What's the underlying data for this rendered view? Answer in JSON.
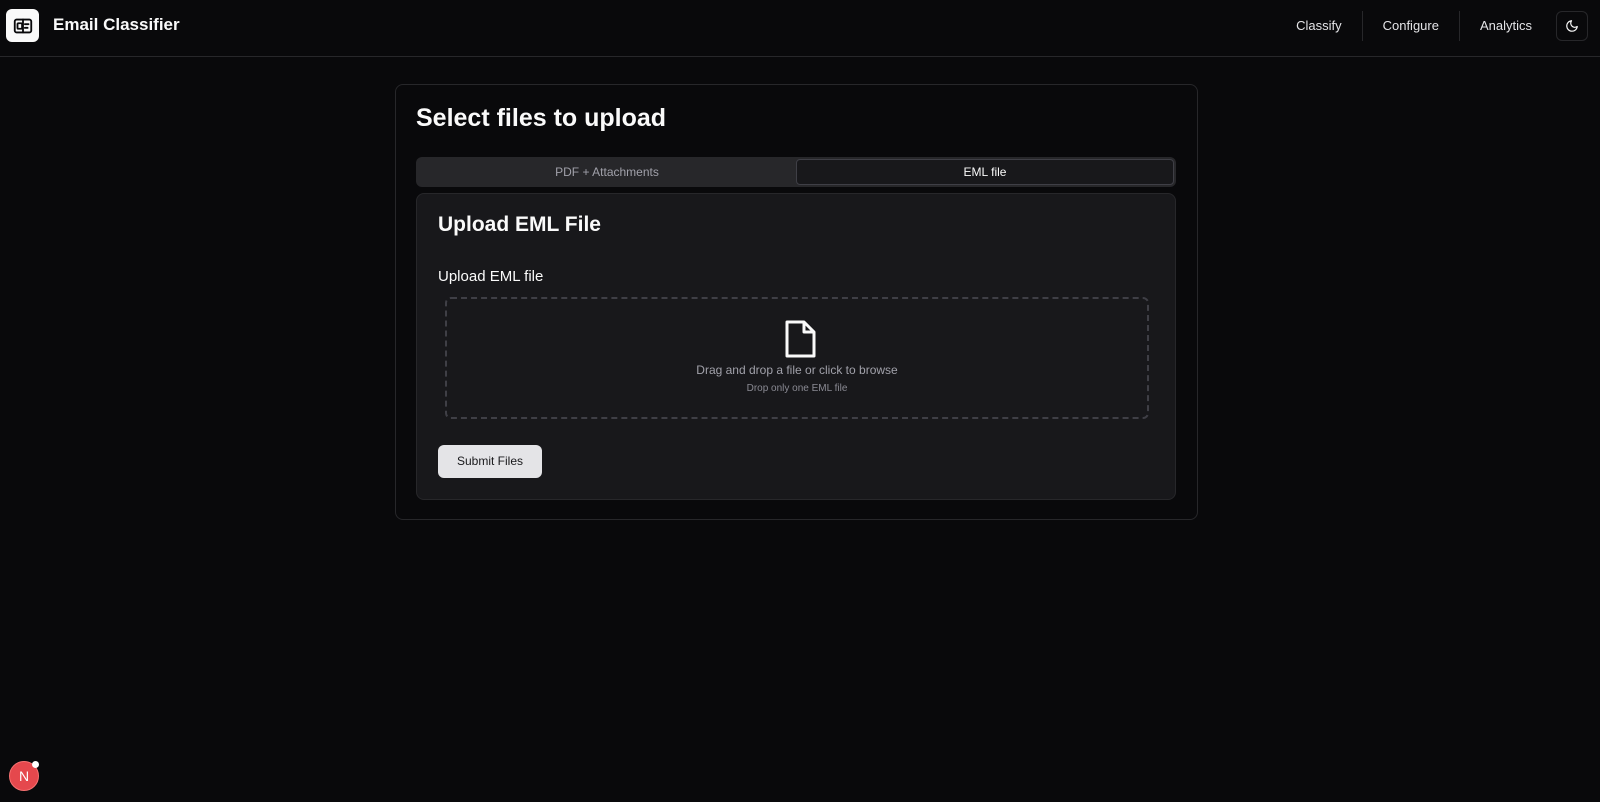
{
  "app": {
    "title": "Email Classifier"
  },
  "nav": {
    "items": [
      {
        "label": "Classify"
      },
      {
        "label": "Configure"
      },
      {
        "label": "Analytics"
      }
    ]
  },
  "page": {
    "title": "Select files to upload",
    "tabs": [
      {
        "label": "PDF + Attachments",
        "active": false
      },
      {
        "label": "EML file",
        "active": true
      }
    ]
  },
  "upload": {
    "card_title": "Upload EML File",
    "field_label": "Upload EML file",
    "dropzone_text": "Drag and drop a file or click to browse",
    "dropzone_hint": "Drop only one EML file",
    "submit_label": "Submit Files"
  },
  "user": {
    "avatar_initial": "N"
  },
  "icons": {
    "logo": "id-card-icon",
    "theme": "moon-icon",
    "file": "file-icon"
  },
  "colors": {
    "background": "#09090b",
    "card": "#18181b",
    "border": "#27272a",
    "avatar": "#e5484d"
  }
}
